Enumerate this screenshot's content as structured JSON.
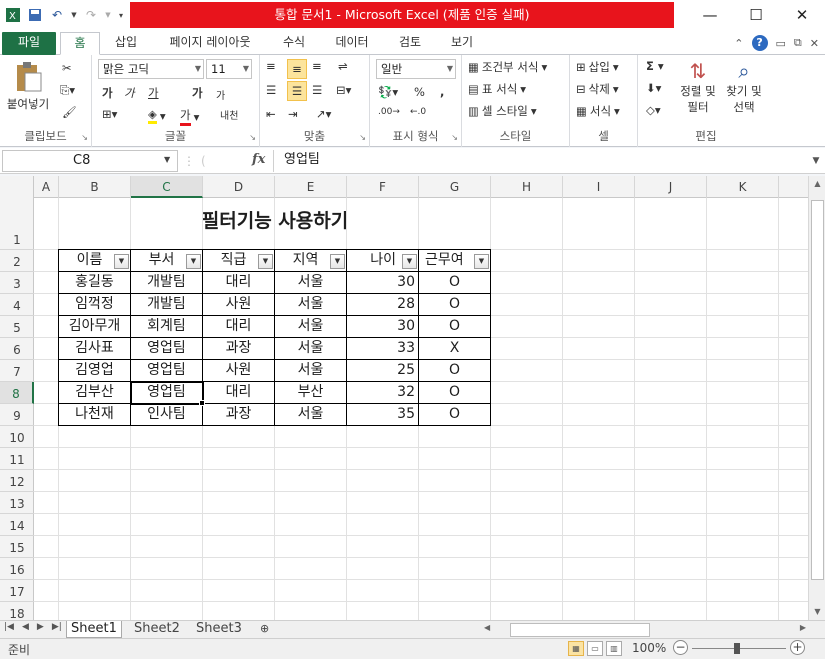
{
  "app": {
    "title": "통합 문서1 - Microsoft Excel (제품 인증 실패)"
  },
  "qat": {
    "icons": [
      "excel-logo",
      "save",
      "undo",
      "redo",
      "customize"
    ]
  },
  "window_controls": {
    "minimize": "—",
    "maximize": "☐",
    "close": "✕"
  },
  "tabs": [
    {
      "label": "파일"
    },
    {
      "label": "홈"
    },
    {
      "label": "삽입"
    },
    {
      "label": "페이지 레이아웃"
    },
    {
      "label": "수식"
    },
    {
      "label": "데이터"
    },
    {
      "label": "검토"
    },
    {
      "label": "보기"
    }
  ],
  "ribbon": {
    "clipboard": {
      "paste": "붙여넣기",
      "label": "클립보드"
    },
    "font": {
      "name": "맑은 고딕",
      "size": "11",
      "bold": "가",
      "italic": "가",
      "underline": "가",
      "grow": "가",
      "shrink": "가",
      "phonetic": "내천",
      "label": "글꼴"
    },
    "alignment": {
      "label": "맞춤"
    },
    "number": {
      "format": "일반",
      "label": "표시 형식"
    },
    "styles": {
      "conditional": "조건부 서식",
      "table": "표 서식",
      "cell": "셀 스타일",
      "label": "스타일"
    },
    "cells": {
      "insert": "삽입",
      "delete": "삭제",
      "format": "서식",
      "label": "셀"
    },
    "editing": {
      "sort_line1": "정렬 및",
      "sort_line2": "필터",
      "find_line1": "찾기 및",
      "find_line2": "선택",
      "label": "편집"
    }
  },
  "formula_bar": {
    "name_box": "C8",
    "fx": "fx",
    "value": "영업팀"
  },
  "columns": [
    "A",
    "B",
    "C",
    "D",
    "E",
    "F",
    "G",
    "H",
    "I",
    "J",
    "K"
  ],
  "rows": [
    "1",
    "2",
    "3",
    "4",
    "5",
    "6",
    "7",
    "8",
    "9",
    "10",
    "11",
    "12",
    "13",
    "14",
    "15",
    "16",
    "17",
    "18"
  ],
  "sheet": {
    "title": "필터기능 사용하기",
    "headers": [
      "이름",
      "부서",
      "직급",
      "지역",
      "나이",
      "근무여"
    ],
    "data": [
      [
        "홍길동",
        "개발팀",
        "대리",
        "서울",
        "30",
        "O"
      ],
      [
        "임꺽정",
        "개발팀",
        "사원",
        "서울",
        "28",
        "O"
      ],
      [
        "김아무개",
        "회계팀",
        "대리",
        "서울",
        "30",
        "O"
      ],
      [
        "김사표",
        "영업팀",
        "과장",
        "서울",
        "33",
        "X"
      ],
      [
        "김영업",
        "영업팀",
        "사원",
        "서울",
        "25",
        "O"
      ],
      [
        "김부산",
        "영업팀",
        "대리",
        "부산",
        "32",
        "O"
      ],
      [
        "나천재",
        "인사팀",
        "과장",
        "서울",
        "35",
        "O"
      ]
    ]
  },
  "sheet_tabs": [
    "Sheet1",
    "Sheet2",
    "Sheet3"
  ],
  "status": {
    "ready": "준비",
    "zoom": "100%"
  },
  "colors": {
    "accent": "#217346",
    "title_bar": "#e8141c",
    "file_tab": "#1e7145"
  }
}
